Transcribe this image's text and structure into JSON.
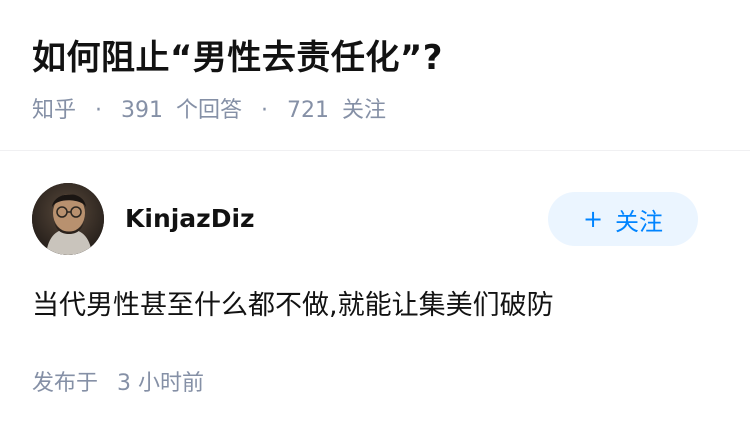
{
  "question": {
    "title": "如何阻止“男性去责任化”?",
    "source": "知乎",
    "separator": "·",
    "answer_count": "391",
    "answer_label": "个回答",
    "follower_count": "721",
    "follower_label": "关注"
  },
  "author": {
    "name": "KinjazDiz",
    "avatar_icon": "avatar-photo",
    "follow_icon": "plus-icon",
    "follow_plus": "+",
    "follow_label": "关注"
  },
  "answer": {
    "content": "当代男性甚至什么都不做,就能让集美们破防",
    "published_prefix": "发布于",
    "published_time": "3 小时前"
  },
  "colors": {
    "title": "#121212",
    "meta": "#8590a6",
    "accent": "#0084ff",
    "follow_button_bg": "#ebf5ff"
  }
}
